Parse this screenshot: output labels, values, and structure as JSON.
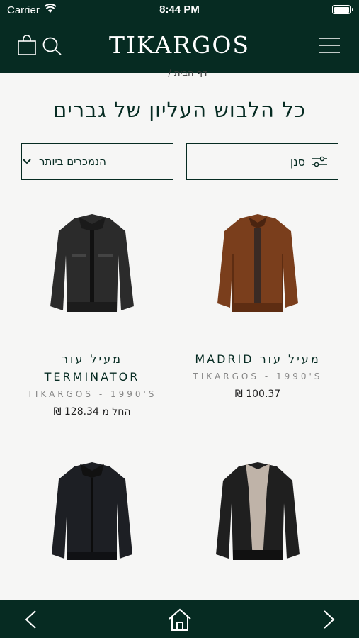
{
  "status_bar": {
    "carrier": "Carrier",
    "time": "8:44 PM"
  },
  "header": {
    "logo": "TIKARGOS"
  },
  "breadcrumb": "דף הבית /",
  "page_title": "כל הלבוש העליון של גברים",
  "filters": {
    "sort_label": "הנמכרים ביותר",
    "filter_label": "סנן"
  },
  "products": [
    {
      "name": "מעיל עור MADRID",
      "brand": "TIKARGOS - 1990'S",
      "price": "100.37 ₪"
    },
    {
      "name": "מעיל עור TERMINATOR",
      "brand": "TIKARGOS - 1990'S",
      "price": "החל מ 128.34 ₪"
    },
    {
      "name": "",
      "brand": "",
      "price": ""
    },
    {
      "name": "",
      "brand": "",
      "price": ""
    }
  ],
  "icons": [
    "bag-icon",
    "search-icon",
    "menu-icon",
    "back-icon",
    "home-icon",
    "forward-icon",
    "sliders-icon",
    "chevron-down-icon"
  ]
}
